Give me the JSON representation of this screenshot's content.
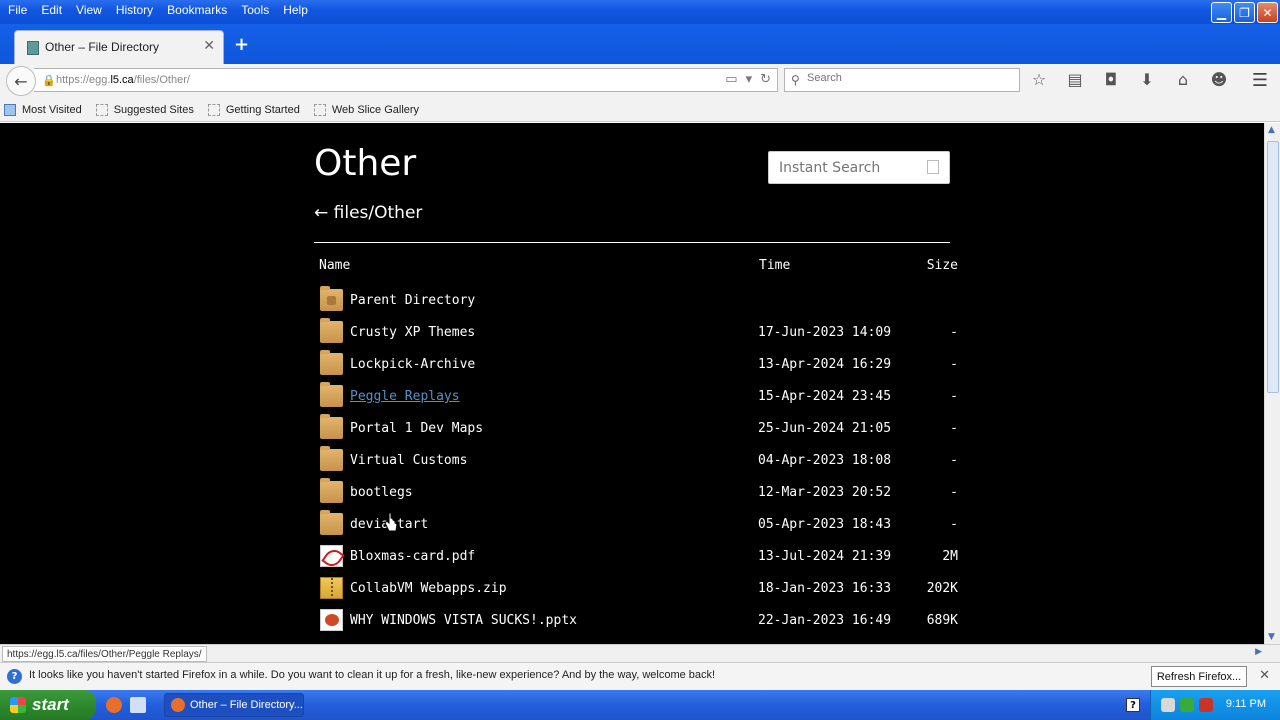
{
  "window": {
    "menus": [
      "File",
      "Edit",
      "View",
      "History",
      "Bookmarks",
      "Tools",
      "Help"
    ]
  },
  "tab": {
    "title": "Other – File Directory"
  },
  "navbar": {
    "url_prefix": "https://egg.",
    "url_host": "l5.ca",
    "url_path": "/files/Other/",
    "search_placeholder": "Search"
  },
  "bookmarks": [
    "Most Visited",
    "Suggested Sites",
    "Getting Started",
    "Web Slice Gallery"
  ],
  "page": {
    "title": "Other",
    "instant_search_placeholder": "Instant Search",
    "breadcrumb": "← files/Other",
    "columns": {
      "name": "Name",
      "time": "Time",
      "size": "Size"
    },
    "rows": [
      {
        "name": "Parent Directory",
        "time": "",
        "size": "",
        "icon": "parent-folder-icon"
      },
      {
        "name": "Crusty XP Themes",
        "time": "17-Jun-2023 14:09",
        "size": "-",
        "icon": "folder-icon"
      },
      {
        "name": "Lockpick-Archive",
        "time": "13-Apr-2024 16:29",
        "size": "-",
        "icon": "folder-icon"
      },
      {
        "name": "Peggle Replays",
        "time": "15-Apr-2024 23:45",
        "size": "-",
        "icon": "folder-icon",
        "hovered": true
      },
      {
        "name": "Portal 1 Dev Maps",
        "time": "25-Jun-2024 21:05",
        "size": "-",
        "icon": "folder-icon"
      },
      {
        "name": "Virtual Customs",
        "time": "04-Apr-2023 18:08",
        "size": "-",
        "icon": "folder-icon"
      },
      {
        "name": "bootlegs",
        "time": "12-Mar-2023 20:52",
        "size": "-",
        "icon": "folder-icon"
      },
      {
        "name": "deviantart",
        "time": "05-Apr-2023 18:43",
        "size": "-",
        "icon": "folder-icon"
      },
      {
        "name": "Bloxmas-card.pdf",
        "time": "13-Jul-2024 21:39",
        "size": "2M",
        "icon": "pdf-icon"
      },
      {
        "name": "CollabVM Webapps.zip",
        "time": "18-Jan-2023 16:33",
        "size": "202K",
        "icon": "zip-icon"
      },
      {
        "name": "WHY WINDOWS VISTA SUCKS!.pptx",
        "time": "22-Jan-2023 16:49",
        "size": "689K",
        "icon": "pptx-icon"
      }
    ]
  },
  "status": {
    "hover_url": "https://egg.l5.ca/files/Other/Peggle Replays/"
  },
  "notification": {
    "message": "It looks like you haven't started Firefox in a while. Do you want to clean it up for a fresh, like-new experience? And by the way, welcome back!",
    "button": "Refresh Firefox..."
  },
  "taskbar": {
    "start": "start",
    "task_title": "Other – File Directory...",
    "clock": "9:11 PM"
  },
  "colors": {
    "link_hover": "#5a8fc4",
    "page_bg": "#000000",
    "xp_blue": "#245edb",
    "start_green": "#2d8a2d"
  }
}
